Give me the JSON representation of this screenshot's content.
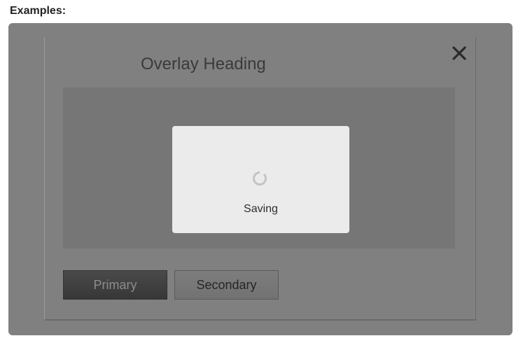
{
  "page": {
    "examples_label": "Examples:"
  },
  "overlay": {
    "heading": "Overlay Heading",
    "close_icon": "close-icon",
    "loading": {
      "text": "Saving",
      "spinner_icon": "spinner-icon"
    },
    "buttons": {
      "primary": "Primary",
      "secondary": "Secondary"
    }
  },
  "colors": {
    "backdrop": "#808080",
    "content_area": "#767676",
    "dialog_bg": "#ebebeb",
    "primary_button": "#3d3d3d",
    "secondary_button": "#787878"
  }
}
